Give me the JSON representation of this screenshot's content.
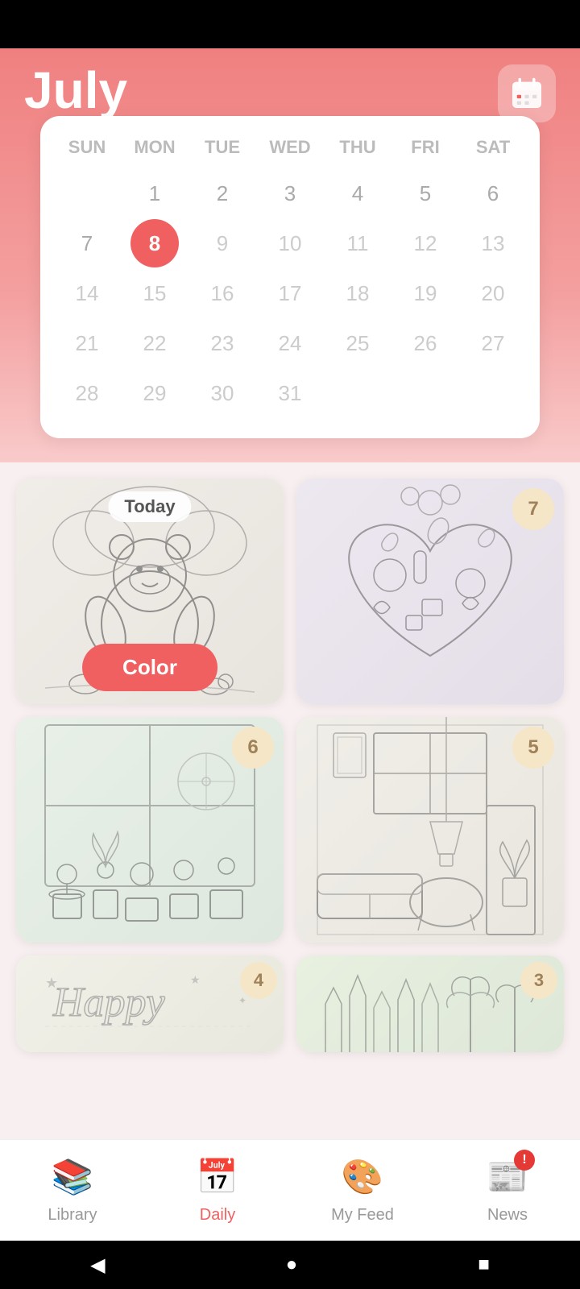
{
  "header": {
    "title": "July",
    "calendar_icon_label": "calendar-icon"
  },
  "calendar": {
    "days_header": [
      "SUN",
      "MON",
      "TUE",
      "WED",
      "THU",
      "FRI",
      "SAT"
    ],
    "rows": [
      [
        "",
        "1",
        "2",
        "3",
        "4",
        "5",
        "6"
      ],
      [
        "7",
        "8",
        "9",
        "10",
        "11",
        "12",
        "13"
      ],
      [
        "14",
        "15",
        "16",
        "17",
        "18",
        "19",
        "20"
      ],
      [
        "21",
        "22",
        "23",
        "24",
        "25",
        "26",
        "27"
      ],
      [
        "28",
        "29",
        "30",
        "31",
        "",
        "",
        ""
      ]
    ],
    "today": "8",
    "today_col": 1
  },
  "cards": [
    {
      "day": "Today",
      "is_today": true,
      "action": "Color",
      "art_type": "bear"
    },
    {
      "day": "7",
      "is_today": false,
      "action": null,
      "art_type": "candy"
    },
    {
      "day": "6",
      "is_today": false,
      "action": null,
      "art_type": "garden"
    },
    {
      "day": "5",
      "is_today": false,
      "action": null,
      "art_type": "room"
    }
  ],
  "partial_cards": [
    {
      "day": "4",
      "art_type": "happy"
    },
    {
      "day": "3",
      "art_type": "jungle"
    }
  ],
  "bottom_nav": {
    "items": [
      {
        "id": "library",
        "label": "Library",
        "icon": "📚",
        "active": false
      },
      {
        "id": "daily",
        "label": "Daily",
        "icon": "📅",
        "active": true
      },
      {
        "id": "myfeed",
        "label": "My Feed",
        "icon": "🎨",
        "active": false
      },
      {
        "id": "news",
        "label": "News",
        "icon": "📰",
        "active": false,
        "badge": "!"
      }
    ]
  },
  "android_nav": {
    "back": "◀",
    "home": "●",
    "recents": "■"
  }
}
